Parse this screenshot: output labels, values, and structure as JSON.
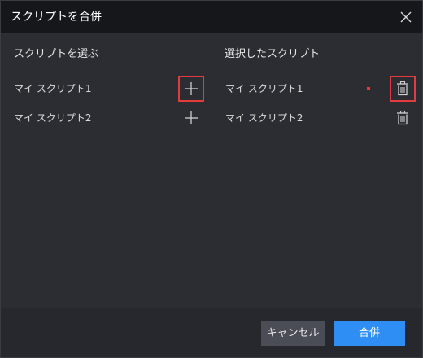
{
  "dialog": {
    "title": "スクリプトを合併",
    "close_icon": "close-icon"
  },
  "left_panel": {
    "heading": "スクリプトを選ぶ",
    "items": [
      {
        "label": "マイ スクリプト1",
        "action_icon": "plus-icon",
        "highlighted": true
      },
      {
        "label": "マイ スクリプト2",
        "action_icon": "plus-icon",
        "highlighted": false
      }
    ]
  },
  "right_panel": {
    "heading": "選択したスクリプト",
    "items": [
      {
        "label": "マイ スクリプト1",
        "action_icon": "trash-icon",
        "highlighted": true
      },
      {
        "label": "マイ スクリプト2",
        "action_icon": "trash-icon",
        "highlighted": false
      }
    ]
  },
  "footer": {
    "cancel_label": "キャンセル",
    "merge_label": "合併"
  },
  "colors": {
    "accent": "#2f8ef4",
    "highlight": "#e23b3b",
    "titlebar_bg": "#16171a",
    "panel_bg": "#2b2d32"
  }
}
